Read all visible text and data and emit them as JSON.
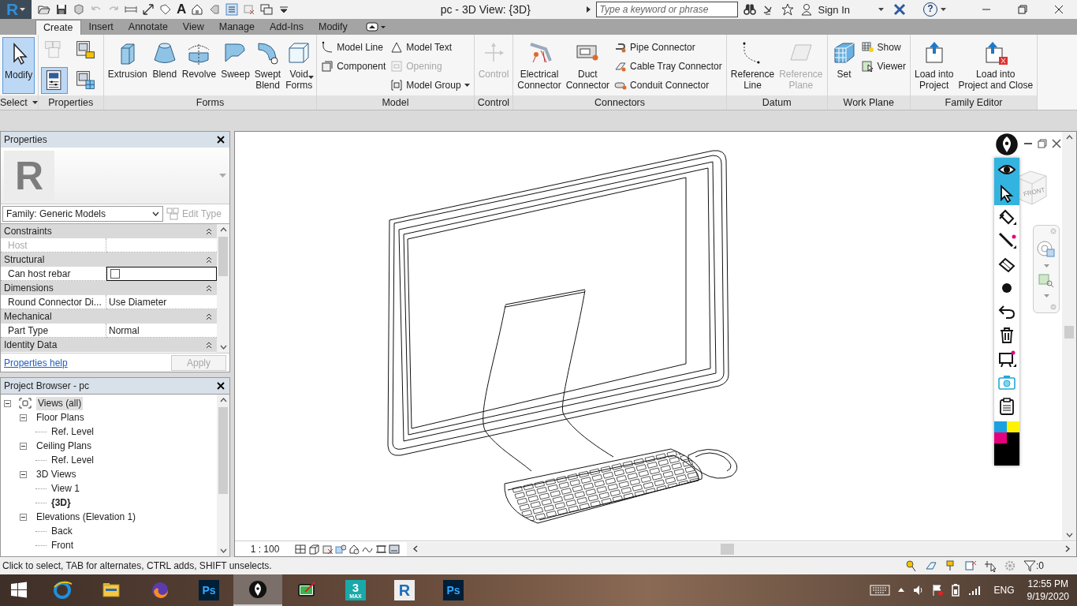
{
  "app_button": {
    "label": "R"
  },
  "quick_access": {
    "text_tool": "A"
  },
  "window": {
    "title": "pc - 3D View: {3D}"
  },
  "search": {
    "placeholder": "Type a keyword or phrase"
  },
  "account": {
    "sign_in": "Sign In",
    "help": "?"
  },
  "tabs": [
    {
      "label": "Create",
      "selected": true
    },
    {
      "label": "Insert",
      "selected": false
    },
    {
      "label": "Annotate",
      "selected": false
    },
    {
      "label": "View",
      "selected": false
    },
    {
      "label": "Manage",
      "selected": false
    },
    {
      "label": "Add-Ins",
      "selected": false
    },
    {
      "label": "Modify",
      "selected": false
    }
  ],
  "ribbon": {
    "panels": [
      {
        "title": "Select",
        "menu": true,
        "items": [
          {
            "kind": "large",
            "label": "Modify",
            "selected": true,
            "disabled": false,
            "menu": false
          }
        ]
      },
      {
        "title": "Properties",
        "menu": false,
        "items": [
          {
            "kind": "tools",
            "tools": [
              {
                "selected": false
              },
              {
                "selected": false
              },
              {
                "selected": true
              },
              {
                "selected": false
              }
            ]
          }
        ]
      },
      {
        "title": "Forms",
        "menu": false,
        "items": [
          {
            "kind": "large",
            "label": "Extrusion",
            "selected": false,
            "disabled": false,
            "menu": false
          },
          {
            "kind": "large",
            "label": "Blend",
            "selected": false,
            "disabled": false,
            "menu": false
          },
          {
            "kind": "large",
            "label": "Revolve",
            "selected": false,
            "disabled": false,
            "menu": false
          },
          {
            "kind": "large",
            "label": "Sweep",
            "selected": false,
            "disabled": false,
            "menu": false
          },
          {
            "kind": "large",
            "label": "Swept\nBlend",
            "selected": false,
            "disabled": false,
            "menu": false
          },
          {
            "kind": "large",
            "label": "Void\nForms",
            "selected": false,
            "disabled": false,
            "menu": true
          }
        ]
      },
      {
        "title": "Model",
        "menu": false,
        "items": [
          {
            "kind": "column",
            "buttons": [
              {
                "label": "Model Line",
                "selected": false,
                "disabled": false,
                "menu": false
              },
              {
                "label": "Component",
                "selected": false,
                "disabled": false,
                "menu": false
              }
            ]
          },
          {
            "kind": "column",
            "buttons": [
              {
                "label": "Model Text",
                "selected": false,
                "disabled": false,
                "menu": false
              },
              {
                "label": "Opening",
                "selected": false,
                "disabled": true,
                "menu": false
              },
              {
                "label": "Model Group",
                "selected": false,
                "disabled": false,
                "menu": true
              }
            ]
          }
        ]
      },
      {
        "title": "Control",
        "menu": false,
        "items": [
          {
            "kind": "large",
            "label": "Control",
            "selected": false,
            "disabled": true,
            "menu": false
          }
        ]
      },
      {
        "title": "Connectors",
        "menu": false,
        "items": [
          {
            "kind": "large",
            "label": "Electrical\nConnector",
            "selected": false,
            "disabled": false,
            "menu": false
          },
          {
            "kind": "large",
            "label": "Duct\nConnector",
            "selected": false,
            "disabled": false,
            "menu": false
          },
          {
            "kind": "column",
            "buttons": [
              {
                "label": "Pipe Connector",
                "selected": false,
                "disabled": false,
                "menu": false
              },
              {
                "label": "Cable Tray Connector",
                "selected": false,
                "disabled": false,
                "menu": false
              },
              {
                "label": "Conduit Connector",
                "selected": false,
                "disabled": false,
                "menu": false
              }
            ]
          }
        ]
      },
      {
        "title": "Datum",
        "menu": false,
        "items": [
          {
            "kind": "large",
            "label": "Reference\nLine",
            "selected": false,
            "disabled": false,
            "menu": false
          },
          {
            "kind": "large",
            "label": "Reference\nPlane",
            "selected": false,
            "disabled": true,
            "menu": false
          }
        ]
      },
      {
        "title": "Work Plane",
        "menu": false,
        "items": [
          {
            "kind": "large",
            "label": "Set",
            "selected": false,
            "disabled": false,
            "menu": false
          },
          {
            "kind": "column",
            "buttons": [
              {
                "label": "Show",
                "selected": false,
                "disabled": false,
                "menu": false
              },
              {
                "label": "Viewer",
                "selected": false,
                "disabled": false,
                "menu": false
              }
            ]
          }
        ]
      },
      {
        "title": "Family Editor",
        "menu": false,
        "items": [
          {
            "kind": "large",
            "label": "Load into\nProject",
            "selected": false,
            "disabled": false,
            "menu": false
          },
          {
            "kind": "large",
            "label": "Load into\nProject and Close",
            "selected": false,
            "disabled": false,
            "menu": false
          }
        ]
      }
    ]
  },
  "properties": {
    "title": "Properties",
    "type_image": "R",
    "type_selector": "Family: Generic Models",
    "edit_type": {
      "label": "Edit Type",
      "disabled": true
    },
    "groups": [
      {
        "name": "Constraints",
        "rows": [
          {
            "kind": "text",
            "label": "Host",
            "disabled": true
          }
        ]
      },
      {
        "name": "Structural",
        "rows": [
          {
            "kind": "checkbox",
            "label": "Can host rebar",
            "disabled": false,
            "checked": false
          }
        ]
      },
      {
        "name": "Dimensions",
        "rows": [
          {
            "kind": "text",
            "label": "Round Connector Di...",
            "value": "Use Diameter",
            "disabled": false
          }
        ]
      },
      {
        "name": "Mechanical",
        "rows": [
          {
            "kind": "text",
            "label": "Part Type",
            "value": "Normal",
            "disabled": false
          }
        ]
      },
      {
        "name": "Identity Data"
      }
    ],
    "help_link": "Properties help",
    "apply": {
      "label": "Apply",
      "disabled": true
    }
  },
  "project_browser": {
    "title": "Project Browser - pc",
    "tree": [
      {
        "label": "Views (all)",
        "selected": true,
        "current": false,
        "expanded": true,
        "children": [
          {
            "label": "Floor Plans",
            "selected": false,
            "current": false,
            "expanded": true,
            "children": [
              {
                "label": "Ref. Level",
                "selected": false,
                "current": false
              }
            ]
          },
          {
            "label": "Ceiling Plans",
            "selected": false,
            "current": false,
            "expanded": true,
            "children": [
              {
                "label": "Ref. Level",
                "selected": false,
                "current": false
              }
            ]
          },
          {
            "label": "3D Views",
            "selected": false,
            "current": false,
            "expanded": true,
            "children": [
              {
                "label": "View 1",
                "selected": false,
                "current": false
              },
              {
                "label": "{3D}",
                "selected": false,
                "current": true
              }
            ]
          },
          {
            "label": "Elevations (Elevation 1)",
            "selected": false,
            "current": false,
            "expanded": true,
            "children": [
              {
                "label": "Back",
                "selected": false,
                "current": false
              },
              {
                "label": "Front",
                "selected": false,
                "current": false
              }
            ]
          }
        ]
      }
    ]
  },
  "view": {
    "scale": "1 : 100",
    "view_cube": "FRONT"
  },
  "palette": {
    "tools": [
      {
        "kind": "eye",
        "selected": true
      },
      {
        "kind": "pointer",
        "selected": true
      },
      {
        "kind": "highlighter",
        "selected": false
      },
      {
        "kind": "pen",
        "selected": false
      },
      {
        "kind": "eraser",
        "selected": false
      },
      {
        "kind": "dot",
        "selected": false
      },
      {
        "kind": "undo",
        "selected": false
      },
      {
        "kind": "trash",
        "selected": false
      },
      {
        "kind": "board",
        "selected": false
      },
      {
        "kind": "camera",
        "selected": false
      },
      {
        "kind": "clipboard",
        "selected": false
      }
    ],
    "colors": [
      {
        "color": "#1ba1e2"
      },
      {
        "color": "#fff200"
      },
      {
        "color": "#e4007c"
      },
      {
        "color": "#000000"
      }
    ]
  },
  "status_bar": {
    "text": "Click to select, TAB for alternates, CTRL adds, SHIFT unselects.",
    "filter_count": ":0"
  },
  "taskbar": {
    "apps": [
      {
        "kind": "browser",
        "selected": false
      },
      {
        "kind": "folder",
        "selected": false
      },
      {
        "kind": "fox",
        "selected": false
      },
      {
        "kind": "letters",
        "label": "Ps",
        "selected": false
      },
      {
        "kind": "pen",
        "selected": true
      },
      {
        "kind": "board",
        "selected": false
      },
      {
        "kind": "letters3",
        "label": "3",
        "sublabel": "MAX",
        "selected": false
      },
      {
        "kind": "lettersR",
        "label": "R",
        "selected": false
      },
      {
        "kind": "letters",
        "label": "Ps",
        "selected": false
      }
    ],
    "language": "ENG",
    "time": "12:55 PM",
    "date": "9/19/2020"
  }
}
